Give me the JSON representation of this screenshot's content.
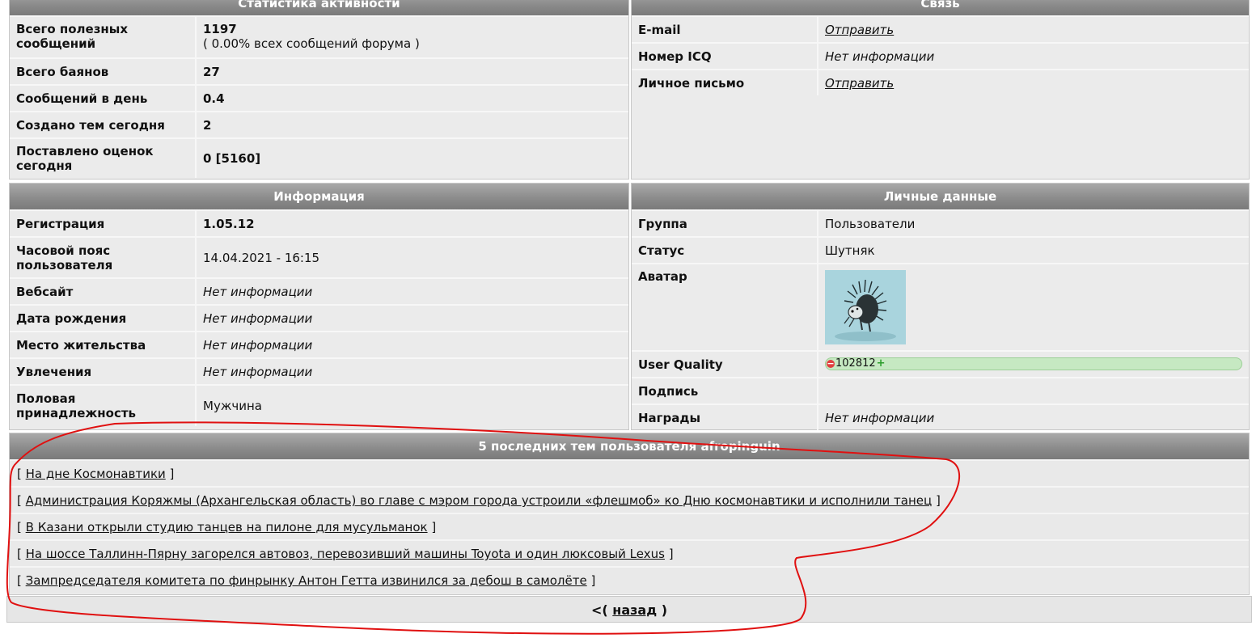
{
  "activity": {
    "title": "Статистика активности",
    "rows": [
      {
        "label": "Всего полезных сообщений",
        "value": "1197",
        "sub": "( 0.00% всех сообщений форума )"
      },
      {
        "label": "Всего баянов",
        "value": "27"
      },
      {
        "label": "Сообщений в день",
        "value": "0.4"
      },
      {
        "label": "Создано тем сегодня",
        "value": "2"
      },
      {
        "label": "Поставлено оценок сегодня",
        "value": "0 [5160]"
      }
    ]
  },
  "contact": {
    "title": "Связь",
    "rows": [
      {
        "label": "E-mail",
        "value": "Отправить"
      },
      {
        "label": "Номер ICQ",
        "value": "Нет информации"
      },
      {
        "label": "Личное письмо",
        "value": "Отправить"
      }
    ]
  },
  "info": {
    "title": "Информация",
    "rows": [
      {
        "label": "Регистрация",
        "value": "1.05.12"
      },
      {
        "label": "Часовой пояс пользователя",
        "value": "14.04.2021 - 16:15"
      },
      {
        "label": "Вебсайт",
        "value": "Нет информации"
      },
      {
        "label": "Дата рождения",
        "value": "Нет информации"
      },
      {
        "label": "Место жительства",
        "value": "Нет информации"
      },
      {
        "label": "Увлечения",
        "value": "Нет информации"
      },
      {
        "label": "Половая принадлежность",
        "value": "Мужчина"
      }
    ]
  },
  "personal": {
    "title": "Личные данные",
    "rows": [
      {
        "label": "Группа",
        "value": "Пользователи"
      },
      {
        "label": "Статус",
        "value": "Шутняк"
      },
      {
        "label": "Аватар",
        "value": ""
      },
      {
        "label": "User Quality",
        "value": "102812"
      },
      {
        "label": "Подпись",
        "value": ""
      },
      {
        "label": "Награды",
        "value": "Нет информации"
      }
    ],
    "avatar_icon": "hedgehog-avatar",
    "uq_minus": "−",
    "uq_plus": "+"
  },
  "topics": {
    "title": "5 последних тем пользователя afropinguin",
    "open": "[",
    "close": "]",
    "items": [
      "На дне Космонавтики",
      "Администрация Коряжмы (Архангельская область) во главе с мэром города устроили «флешмоб» ко Дню космонавтики и исполнили танец",
      "В Казани открыли студию танцев на пилоне для мусульманок",
      "На шоссе Таллинн-Пярну загорелся автовоз, перевозивший машины Toyota и один люксовый Lexus",
      "Зампредседателя комитета по финрынку Антон Гетта извинился за дебош в самолёте"
    ]
  },
  "back": {
    "prefix": "<(",
    "label": "назад",
    "suffix": ")"
  },
  "colors": {
    "header": "#8c8c8c",
    "panel": "#ebebeb",
    "annotation": "#e01010"
  }
}
